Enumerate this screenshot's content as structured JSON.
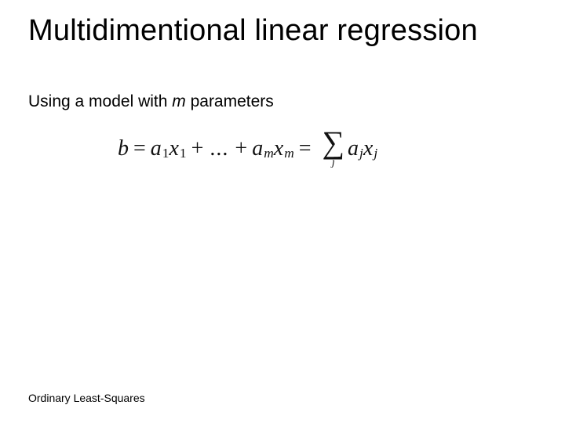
{
  "title": "Multidimentional linear regression",
  "subtitle_pre": "Using a model with ",
  "subtitle_var": "m",
  "subtitle_post": " parameters",
  "eq": {
    "b": "b",
    "a": "a",
    "x": "x",
    "sub1": "1",
    "subm": "m",
    "subj": "j",
    "eq_sign": "=",
    "plus": "+",
    "dots": "...",
    "sigma": "∑",
    "sum_index": "j"
  },
  "footer": "Ordinary Least-Squares"
}
